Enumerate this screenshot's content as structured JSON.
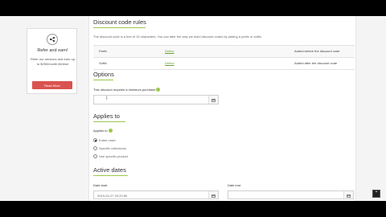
{
  "refer": {
    "title": "Refer and earn!",
    "text": "Refer our services and earn up to $250/month lifetime",
    "button": "Read More"
  },
  "discount_rules": {
    "heading": "Discount code rules",
    "description": "The discount code is a text of 15 characters. You can alter the way we build discount codes by adding a prefix or suffix.",
    "rows": [
      {
        "name": "Prefix",
        "value": "Define",
        "note": "Added before the discount code"
      },
      {
        "name": "Suffix",
        "value": "Define",
        "note": "Added after the discount code"
      }
    ]
  },
  "options": {
    "heading": "Options",
    "min_purchase_label": "This discount requires a minimum purchase",
    "min_purchase_value": ""
  },
  "applies_to": {
    "heading": "Applies to",
    "label": "Applies to",
    "choices": [
      "Entire order",
      "Specific collections",
      "Use specific product"
    ],
    "selected": 0
  },
  "active_dates": {
    "heading": "Active dates",
    "start_label": "Date start",
    "start_value": "2019-02-27 20:20:50",
    "end_label": "Date end",
    "end_value": ""
  },
  "scroll_top_icon": "chevron-up-icon"
}
